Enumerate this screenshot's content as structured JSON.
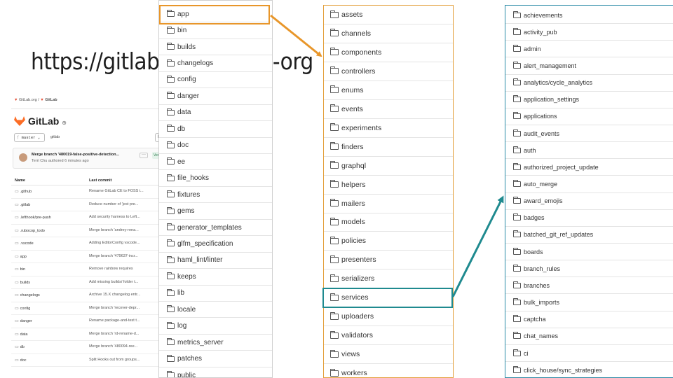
{
  "title_text": "https://gitlab.com/gitlab-org",
  "colors": {
    "orange": "#e8962a",
    "teal": "#1f8a8f",
    "gitlab_fox": "#fc6d26"
  },
  "gitlab": {
    "breadcrumb": [
      "GitLab.org",
      "GitLab"
    ],
    "project_name": "GitLab",
    "branch": "master",
    "project_path": "gitlab",
    "commit_message": "Merge branch '480019-false-positive-detection...",
    "commit_author": "Terri Chu authored 6 minutes ago",
    "commit_more": "···",
    "verified_badge": "Ver",
    "header_btn": "H",
    "headers": {
      "name": "Name",
      "last_commit": "Last commit"
    },
    "rows": [
      {
        "name": ".github",
        "commit": "Rename GitLab CE to FOSS i..."
      },
      {
        "name": ".gitlab",
        "commit": "Reduce number of 'jest pre..."
      },
      {
        "name": ".lefthook/pre-push",
        "commit": "Add security harness to Left..."
      },
      {
        "name": ".rubocop_todo",
        "commit": "Merge branch 'andrey-rena..."
      },
      {
        "name": ".vscode",
        "commit": "Adding EditorConfig vscode..."
      },
      {
        "name": "app",
        "commit": "Merge branch '479637-incr..."
      },
      {
        "name": "bin",
        "commit": "Remove rainbow requires"
      },
      {
        "name": "builds",
        "commit": "Add missing builds/ folder t..."
      },
      {
        "name": "changelogs",
        "commit": "Archive 15.X changelog entr..."
      },
      {
        "name": "config",
        "commit": "Merge branch 'recover-depr..."
      },
      {
        "name": "danger",
        "commit": "Rename package-and-test t..."
      },
      {
        "name": "data",
        "commit": "Merge branch 'rd-rename-d..."
      },
      {
        "name": "db",
        "commit": "Merge branch '480094-ree..."
      },
      {
        "name": "doc",
        "commit": "Split Hooks out from groups..."
      }
    ]
  },
  "root_dirs": [
    "app",
    "bin",
    "builds",
    "changelogs",
    "config",
    "danger",
    "data",
    "db",
    "doc",
    "ee",
    "file_hooks",
    "fixtures",
    "gems",
    "generator_templates",
    "glfm_specification",
    "haml_lint/linter",
    "keeps",
    "lib",
    "locale",
    "log",
    "metrics_server",
    "patches",
    "public"
  ],
  "app_dirs": [
    "assets",
    "channels",
    "components",
    "controllers",
    "enums",
    "events",
    "experiments",
    "finders",
    "graphql",
    "helpers",
    "mailers",
    "models",
    "policies",
    "presenters",
    "serializers",
    "services",
    "uploaders",
    "validators",
    "views",
    "workers"
  ],
  "services_dirs": [
    "achievements",
    "activity_pub",
    "admin",
    "alert_management",
    "analytics/cycle_analytics",
    "application_settings",
    "applications",
    "audit_events",
    "auth",
    "authorized_project_update",
    "auto_merge",
    "award_emojis",
    "badges",
    "batched_git_ref_updates",
    "boards",
    "branch_rules",
    "branches",
    "bulk_imports",
    "captcha",
    "chat_names",
    "ci",
    "click_house/sync_strategies"
  ]
}
